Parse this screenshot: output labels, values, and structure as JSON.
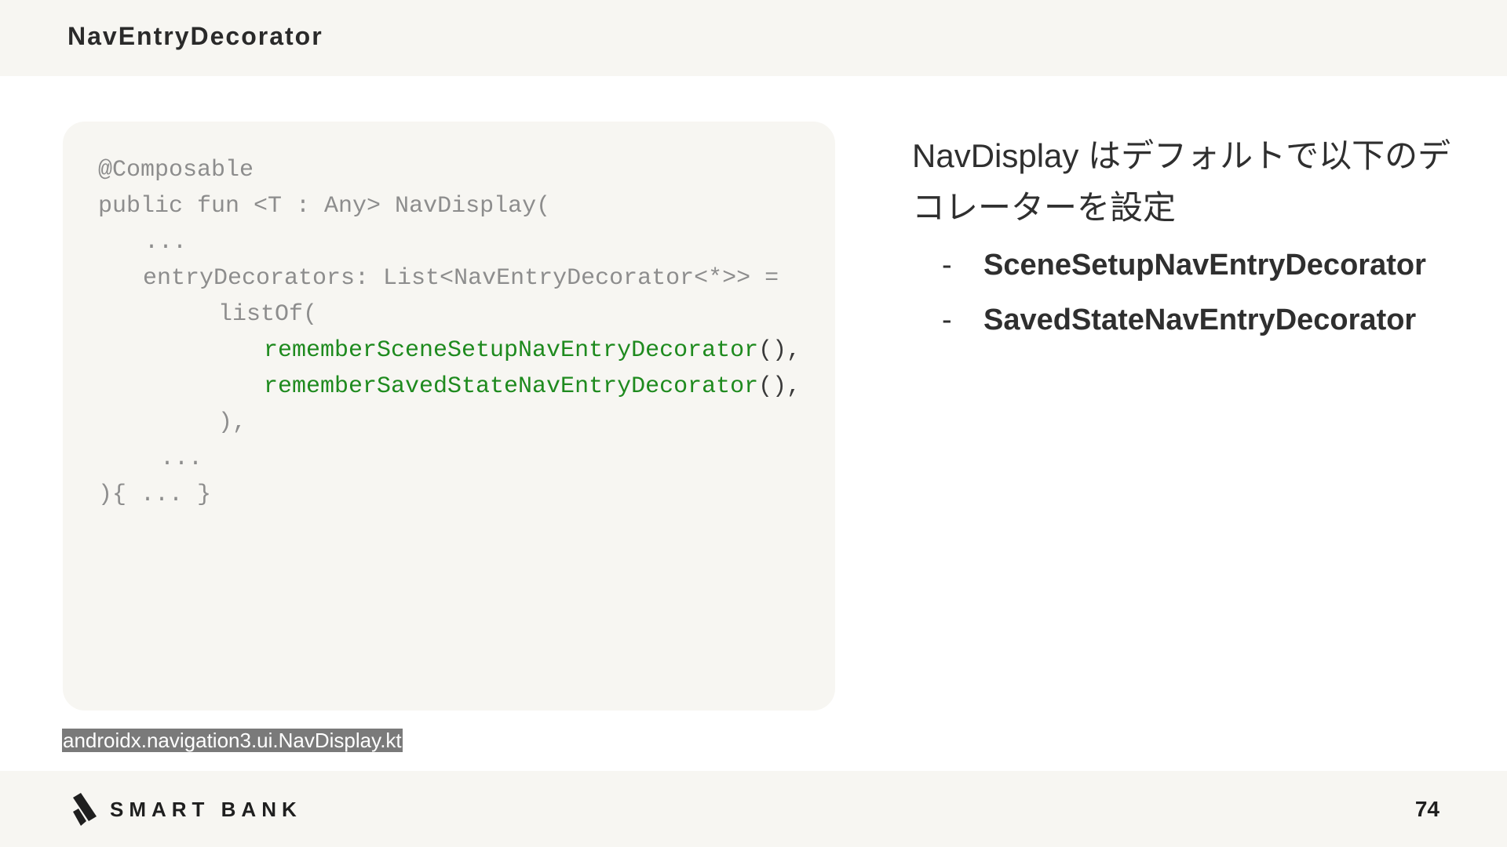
{
  "header": {
    "title": "NavEntryDecorator"
  },
  "code": {
    "lines": [
      {
        "text": "@Composable",
        "color": "#8d8d8d"
      },
      {
        "text": "public fun <T : Any> NavDisplay(",
        "color": "#8d8d8d"
      },
      {
        "text": "...",
        "color": "#8d8d8d"
      },
      {
        "text": "entryDecorators: List<NavEntryDecorator<*>> =",
        "color": "#8d8d8d"
      },
      {
        "text": "listOf(",
        "color": "#8d8d8d"
      },
      {
        "name": "rememberSceneSetupNavEntryDecorator",
        "suffix": "(),",
        "color": "#1e8a1e"
      },
      {
        "name": "rememberSavedStateNavEntryDecorator",
        "suffix": "(),",
        "color": "#1e8a1e"
      },
      {
        "text": "),",
        "color": "#8d8d8d"
      },
      {
        "text": "...",
        "color": "#8d8d8d"
      },
      {
        "text": "){ ... }",
        "color": "#8d8d8d"
      }
    ]
  },
  "source": {
    "label": "androidx.navigation3.ui.NavDisplay.kt"
  },
  "description": {
    "text": "NavDisplay はデフォルトで以下のデコレーターを設定"
  },
  "bullets": [
    {
      "dash": "-",
      "text": "SceneSetupNavEntryDecorator"
    },
    {
      "dash": "-",
      "text": "SavedStateNavEntryDecorator"
    }
  ],
  "footer": {
    "logo_text": "SMART BANK",
    "logo_icon": "smartbank-logo-icon",
    "page_number": "74"
  }
}
